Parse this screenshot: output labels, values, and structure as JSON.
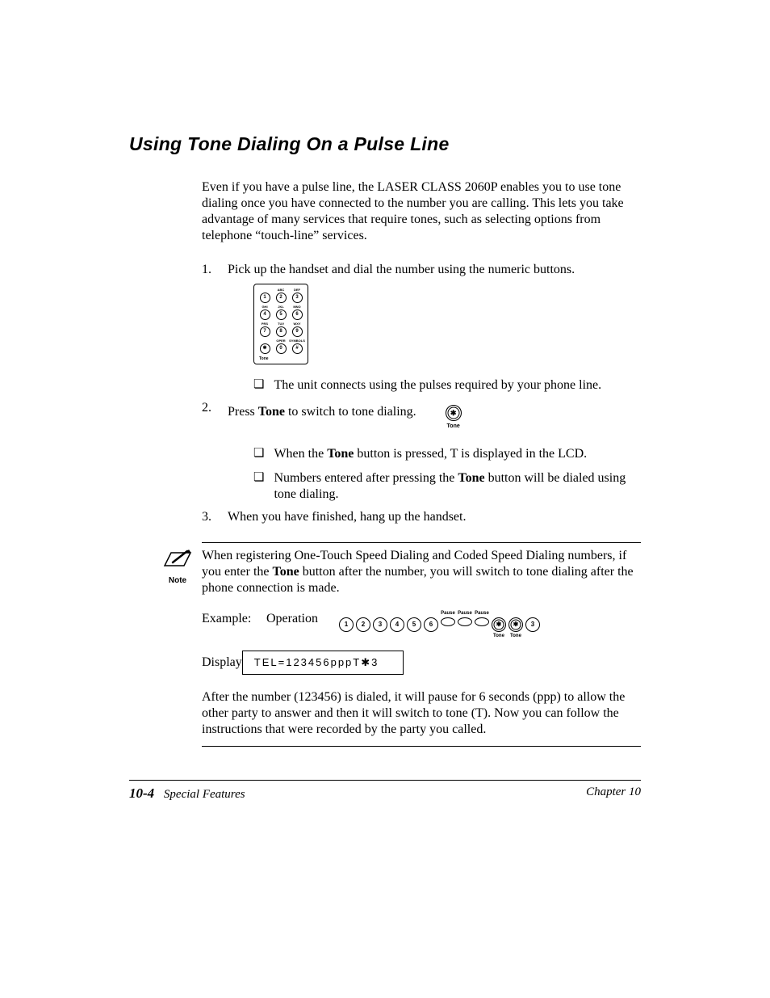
{
  "title": "Using Tone Dialing On a Pulse Line",
  "intro": "Even if you have a pulse line, the LASER CLASS 2060P enables you to use tone dialing once you have connected to the number you are calling. This lets you take advantage of many services that require tones, such as selecting options from telephone “touch-line” services.",
  "steps": {
    "s1": "Pick up the handset and dial the number using the numeric buttons.",
    "s1_note": "The unit connects using the pulses required by your phone line.",
    "s2_a": "Press ",
    "s2_bold": "Tone",
    "s2_b": " to switch to tone dialing.",
    "s2_note1_a": "When the ",
    "s2_note1_bold": "Tone",
    "s2_note1_b": " button is pressed, T is displayed in the LCD.",
    "s2_note2_a": "Numbers entered after pressing the ",
    "s2_note2_bold": "Tone",
    "s2_note2_b": " button will be dialed using tone dialing.",
    "s3": "When you have finished, hang up the handset."
  },
  "keypad": {
    "labels": [
      "",
      "ABC",
      "DEF",
      "GHI",
      "JKL",
      "MNO",
      "PRS",
      "TUV",
      "WXY",
      "",
      "OPER",
      "SYMBOLS"
    ],
    "keys": [
      "1",
      "2",
      "3",
      "4",
      "5",
      "6",
      "7",
      "8",
      "9",
      "✱",
      "0",
      "#"
    ],
    "tone_label": "Tone"
  },
  "tone_button": {
    "glyph": "✱",
    "label": "Tone"
  },
  "note": {
    "icon_label": "Note",
    "p1_a": "When registering One-Touch Speed Dialing and Coded Speed Dialing numbers, if you enter the ",
    "p1_bold": "Tone",
    "p1_b": " button after the number, you will switch to tone dialing after the phone connection is made.",
    "example_label": "Example:",
    "operation_label": "Operation",
    "display_label": "Display",
    "display_value": "TEL=123456pppT✱3",
    "p2": "After the number (123456) is dialed, it will pause for 6 seconds (ppp) to allow the other party to answer and then it will switch to tone (T). Now you can follow the instructions that were recorded by the party you called."
  },
  "operation_seq": {
    "digits": [
      "1",
      "2",
      "3",
      "4",
      "5",
      "6"
    ],
    "pause_label": "Pause",
    "tone_glyph": "✱",
    "tone_label": "Tone",
    "final": "3"
  },
  "footer": {
    "page": "10-4",
    "section": "Special Features",
    "chapter": "Chapter 10"
  }
}
